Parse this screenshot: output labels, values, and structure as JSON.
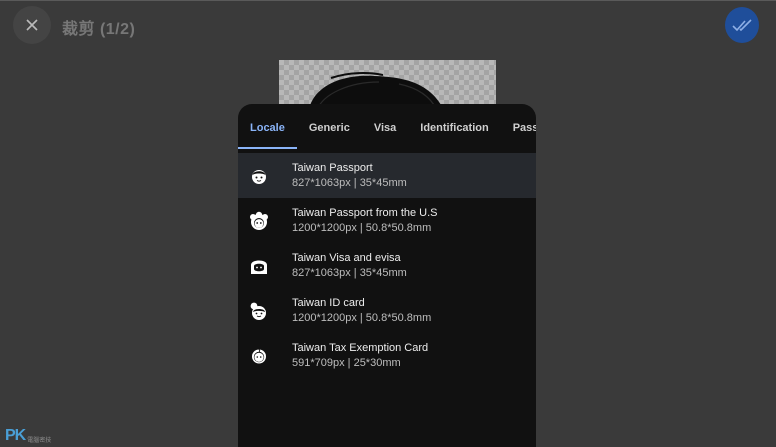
{
  "header": {
    "title": "裁剪 (1/2)"
  },
  "colors": {
    "accent": "#8ab4f8",
    "confirm": "#1f4e9a",
    "sheet_bg": "#111111",
    "selected_row": "#26292e"
  },
  "tabs": [
    {
      "label": "Locale",
      "active": true
    },
    {
      "label": "Generic",
      "active": false
    },
    {
      "label": "Visa",
      "active": false
    },
    {
      "label": "Identification",
      "active": false
    },
    {
      "label": "Passp",
      "active": false
    }
  ],
  "items": [
    {
      "name": "Taiwan Passport",
      "size": "827*1063px | 35*45mm",
      "icon": "face-icon",
      "selected": true
    },
    {
      "name": "Taiwan Passport from the U.S",
      "size": "1200*1200px | 50.8*50.8mm",
      "icon": "curly-hair-face-icon",
      "selected": false
    },
    {
      "name": "Taiwan Visa and evisa",
      "size": "827*1063px | 35*45mm",
      "icon": "long-hair-face-icon",
      "selected": false
    },
    {
      "name": "Taiwan ID card",
      "size": "1200*1200px | 50.8*50.8mm",
      "icon": "bun-hair-face-icon",
      "selected": false
    },
    {
      "name": "Taiwan Tax Exemption Card",
      "size": "591*709px | 25*30mm",
      "icon": "baby-face-icon",
      "selected": false
    }
  ],
  "watermark": {
    "logo": "PK",
    "subtitle": "電腦密技"
  }
}
